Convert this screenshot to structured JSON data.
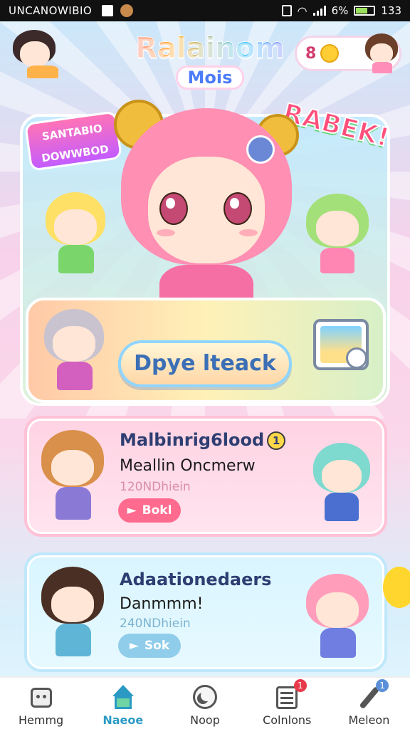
{
  "status_bar": {
    "carrier": "UNCANOWIBIO",
    "battery": "6%",
    "time": "133"
  },
  "header": {
    "title": "Ralainom",
    "subtitle": "Mois",
    "currency_value": "8"
  },
  "hero": {
    "sticker_left": "SANTABIO DOWWBOD",
    "sticker_right": "RABEK!",
    "cta_label": "Dpye lteack"
  },
  "cards": [
    {
      "title": "Malbinrig6lood",
      "subtitle": "Meallin Oncmerw",
      "meta": "120NDhiein",
      "button": "Bokl",
      "badge": "1"
    },
    {
      "title": "Adaationedaers",
      "subtitle": "Danmmm!",
      "meta": "240NDhiein",
      "button": "Sok"
    }
  ],
  "nav": {
    "items": [
      {
        "label": "Hemmg",
        "icon": "robot-icon"
      },
      {
        "label": "Naeoe",
        "icon": "home-icon",
        "active": true
      },
      {
        "label": "Noop",
        "icon": "moon-icon"
      },
      {
        "label": "Colnlons",
        "icon": "list-icon",
        "badge": "1"
      },
      {
        "label": "Meleon",
        "icon": "brush-icon",
        "badge": "1"
      }
    ]
  },
  "colors": {
    "accent_pink": "#ff6b8f",
    "accent_blue": "#8fcdea",
    "active_nav": "#2a9ac4"
  }
}
